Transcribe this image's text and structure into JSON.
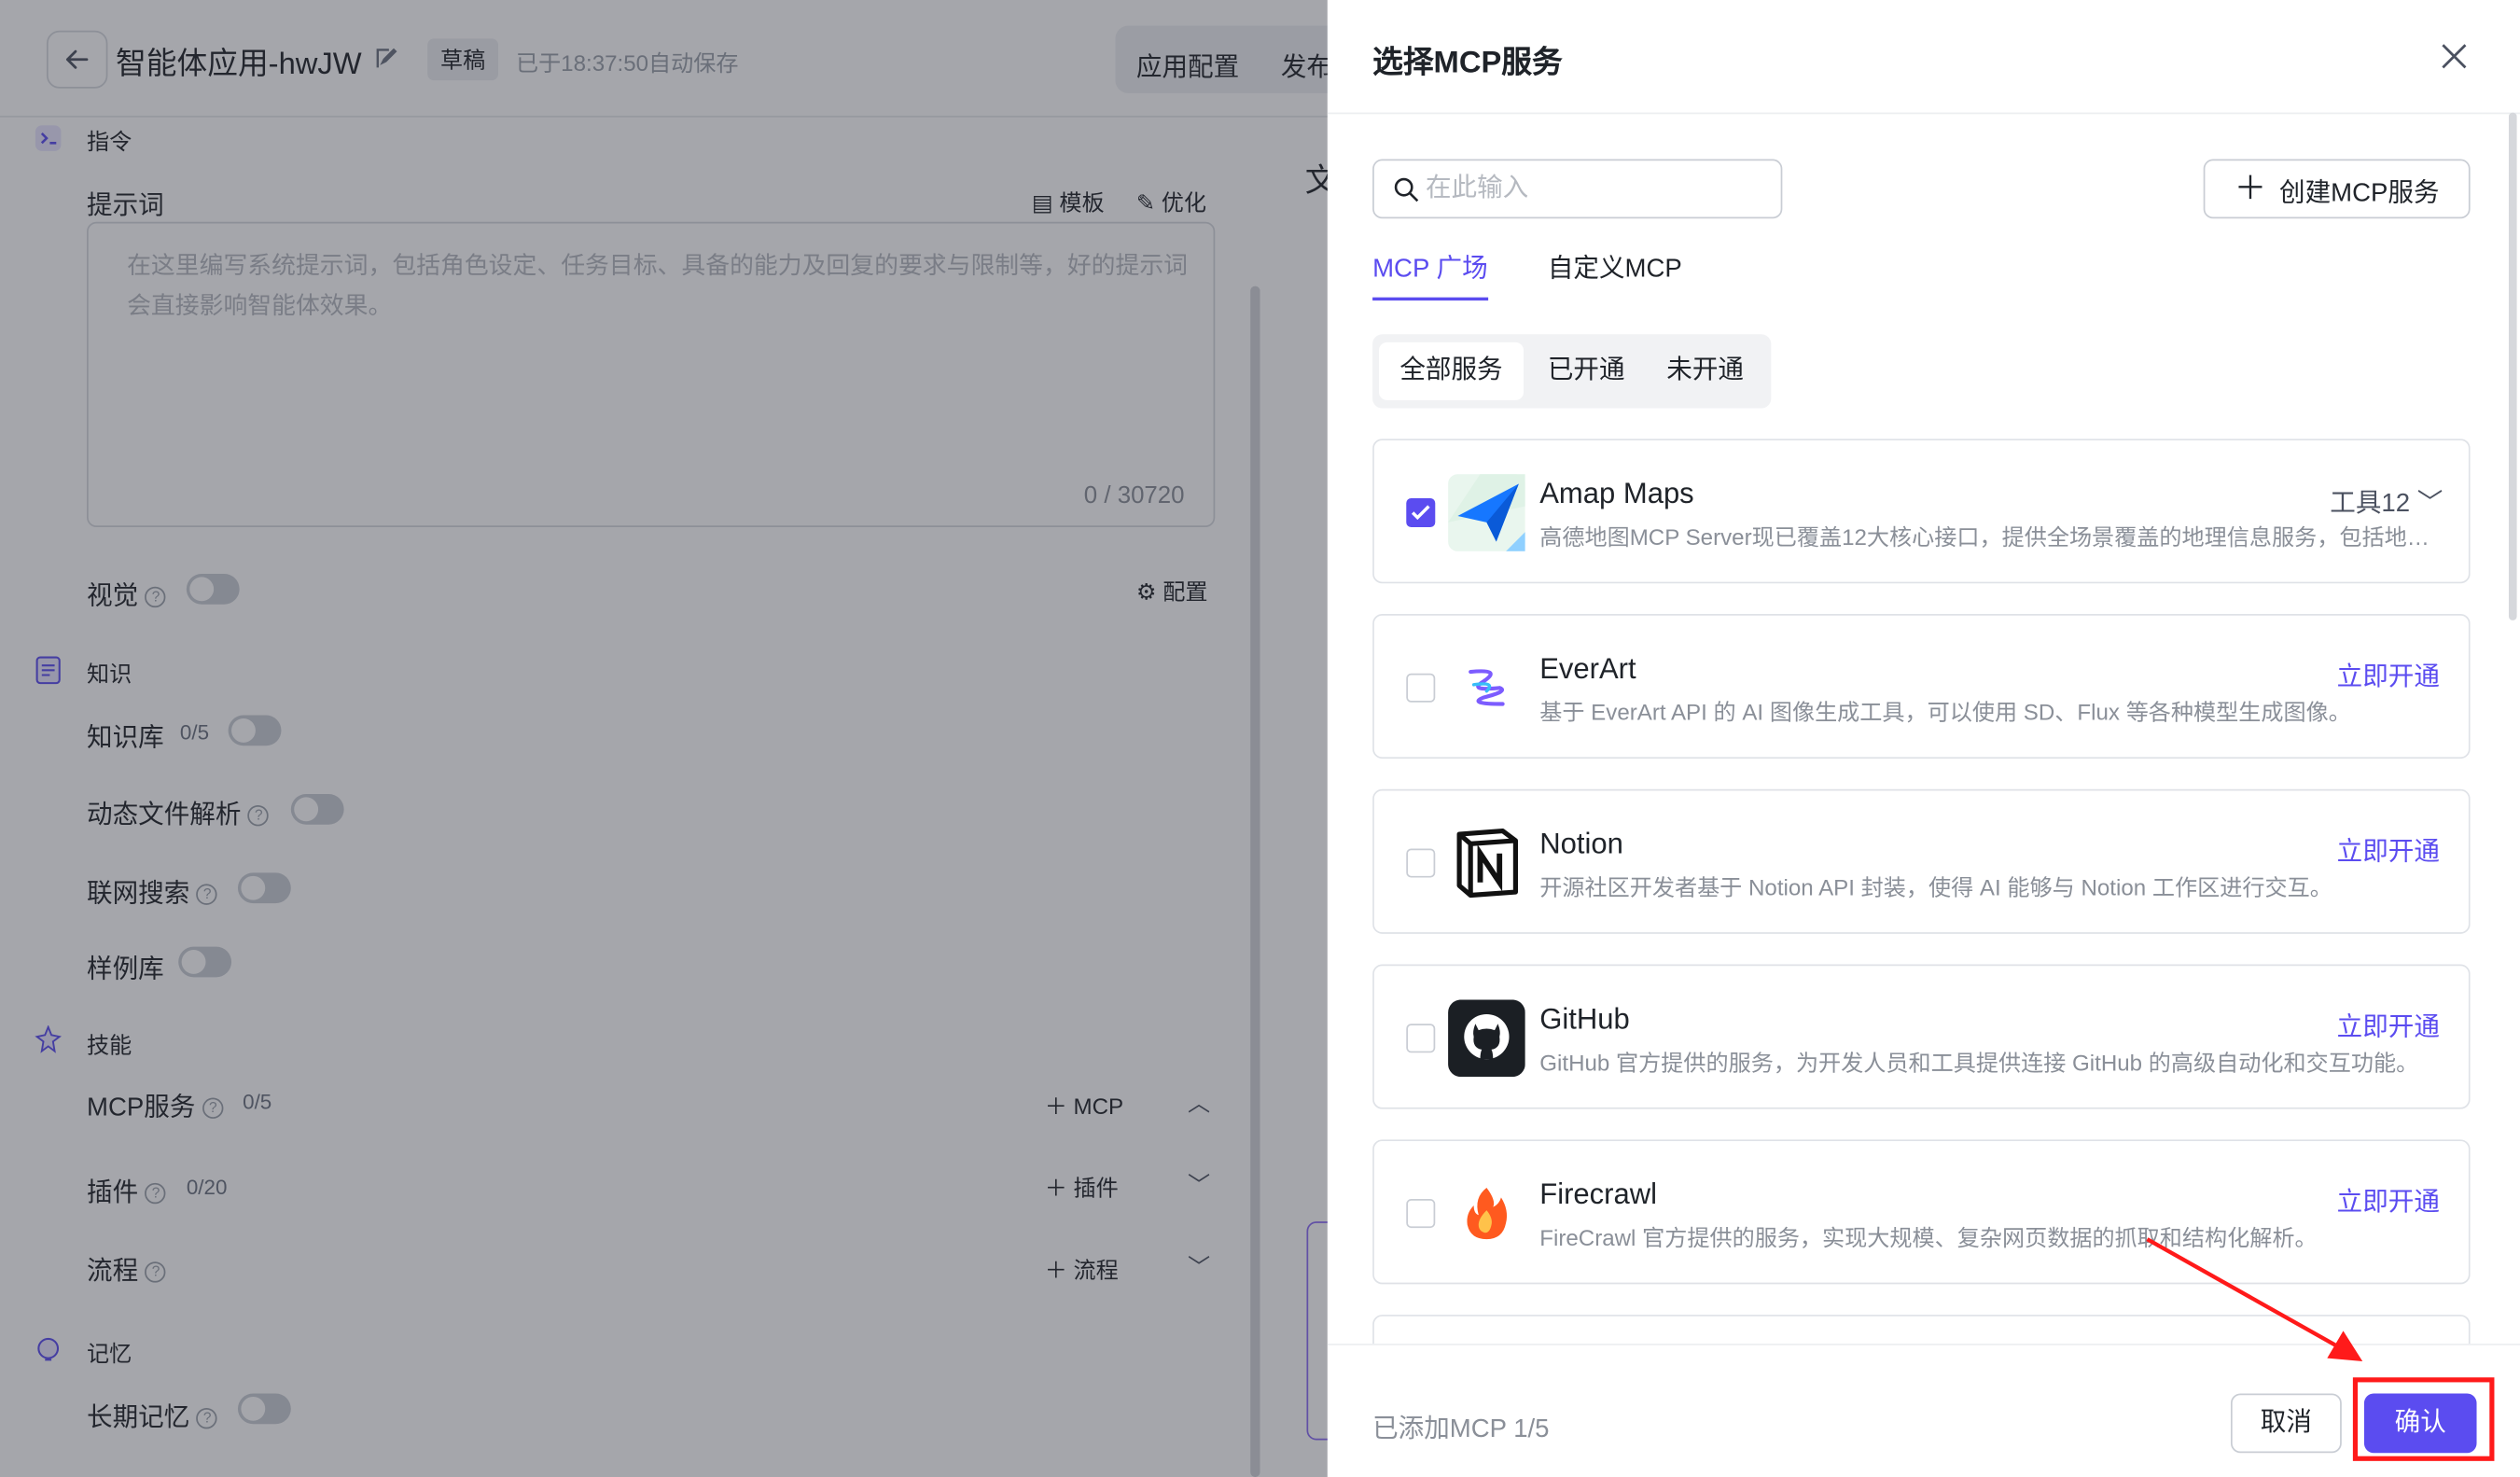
{
  "app": {
    "title": "智能体应用-hwJW",
    "draft_badge": "草稿",
    "autosave": "已于18:37:50自动保存",
    "tabs": [
      "应用配置",
      "发布"
    ],
    "right_peek": "文"
  },
  "instructions": {
    "section_title": "指令",
    "prompt_label": "提示词",
    "template_label": "模板",
    "optimize_label": "优化",
    "placeholder": "在这里编写系统提示词，包括角色设定、任务目标、具备的能力及回复的要求与限制等，好的提示词会直接影响智能体效果。",
    "count": "0 / 30720",
    "vision_label": "视觉",
    "config_label": "配置"
  },
  "knowledge": {
    "section_title": "知识",
    "kb_label": "知识库",
    "kb_count": "0/5",
    "dynamic_file_label": "动态文件解析",
    "web_search_label": "联网搜索",
    "sample_label": "样例库"
  },
  "skills": {
    "section_title": "技能",
    "mcp_label": "MCP服务",
    "mcp_count": "0/5",
    "mcp_add": "MCP",
    "plugin_label": "插件",
    "plugin_count": "0/20",
    "plugin_add": "插件",
    "flow_label": "流程",
    "flow_add": "流程"
  },
  "memory": {
    "section_title": "记忆",
    "long_term_label": "长期记忆"
  },
  "drawer": {
    "title": "选择MCP服务",
    "search_placeholder": "在此输入",
    "create_button": "创建MCP服务",
    "tabs": [
      "MCP 广场",
      "自定义MCP"
    ],
    "filters": [
      "全部服务",
      "已开通",
      "未开通"
    ],
    "services": [
      {
        "name": "Amap Maps",
        "desc": "高德地图MCP Server现已覆盖12大核心接口，提供全场景覆盖的地理信息服务，包括地理编码、逆地理编码、IP定位、天气查询",
        "action": "工具12",
        "checked": true,
        "icon": "amap-maps-icon"
      },
      {
        "name": "EverArt",
        "desc": "基于 EverArt API 的 AI 图像生成工具，可以使用 SD、Flux 等各种模型生成图像。",
        "action": "立即开通",
        "checked": false,
        "icon": "everart-icon"
      },
      {
        "name": "Notion",
        "desc": "开源社区开发者基于 Notion API 封装，使得 AI 能够与 Notion 工作区进行交互。",
        "action": "立即开通",
        "checked": false,
        "icon": "notion-icon"
      },
      {
        "name": "GitHub",
        "desc": "GitHub 官方提供的服务，为开发人员和工具提供连接 GitHub 的高级自动化和交互功能。",
        "action": "立即开通",
        "checked": false,
        "icon": "github-icon"
      },
      {
        "name": "Firecrawl",
        "desc": "FireCrawl 官方提供的服务，实现大规模、复杂网页数据的抓取和结构化解析。",
        "action": "立即开通",
        "checked": false,
        "icon": "firecrawl-icon"
      }
    ],
    "added_text": "已添加MCP 1/5",
    "cancel": "取消",
    "confirm": "确认"
  },
  "colors": {
    "accent": "#5b4cf0",
    "annotation": "#ff1a1a"
  }
}
